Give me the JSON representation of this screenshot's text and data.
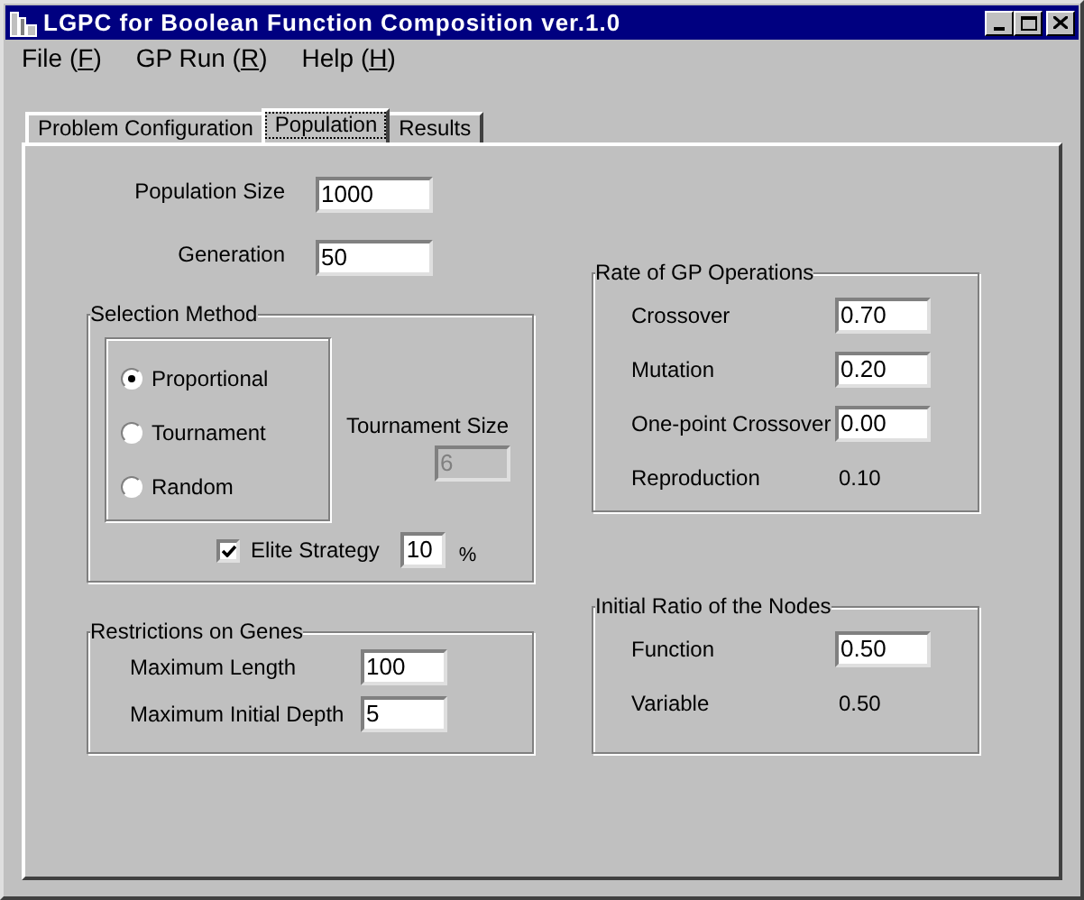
{
  "window": {
    "title": "LGPC for Boolean Function Composition ver.1.0"
  },
  "menu": [
    {
      "label": "File",
      "mnemonic": "(F)"
    },
    {
      "label": "GP Run",
      "mnemonic": "(R)"
    },
    {
      "label": "Help",
      "mnemonic": "(H)"
    }
  ],
  "tabs": [
    {
      "label": "Problem Configuration",
      "selected": false
    },
    {
      "label": "Population",
      "selected": true
    },
    {
      "label": "Results",
      "selected": false
    }
  ],
  "population_size": {
    "label": "Population Size",
    "value": "1000"
  },
  "generation": {
    "label": "Generation",
    "value": "50"
  },
  "selection_method": {
    "title": "Selection Method",
    "options": [
      {
        "label": "Proportional",
        "selected": true
      },
      {
        "label": "Tournament",
        "selected": false
      },
      {
        "label": "Random",
        "selected": false
      }
    ],
    "tournament_size": {
      "label": "Tournament Size",
      "value": "6",
      "disabled": true
    },
    "elite_strategy": {
      "label": "Elite Strategy",
      "checked": true,
      "value": "10",
      "unit": "%"
    }
  },
  "restrictions": {
    "title": "Restrictions on Genes",
    "fields": [
      {
        "label": "Maximum Length",
        "value": "100"
      },
      {
        "label": "Maximum Initial Depth",
        "value": "5"
      }
    ]
  },
  "rates": {
    "title": "Rate of GP Operations",
    "items": [
      {
        "kind": "field",
        "label": "Crossover",
        "value": "0.70"
      },
      {
        "kind": "field",
        "label": "Mutation",
        "value": "0.20"
      },
      {
        "kind": "field",
        "label": "One-point Crossover",
        "value": "0.00"
      },
      {
        "kind": "text",
        "label": "Reproduction",
        "value": "0.10"
      }
    ]
  },
  "initial_ratio": {
    "title": "Initial Ratio of the Nodes",
    "items": [
      {
        "kind": "field",
        "label": "Function",
        "value": "0.50"
      },
      {
        "kind": "text",
        "label": "Variable",
        "value": "0.50"
      }
    ]
  }
}
